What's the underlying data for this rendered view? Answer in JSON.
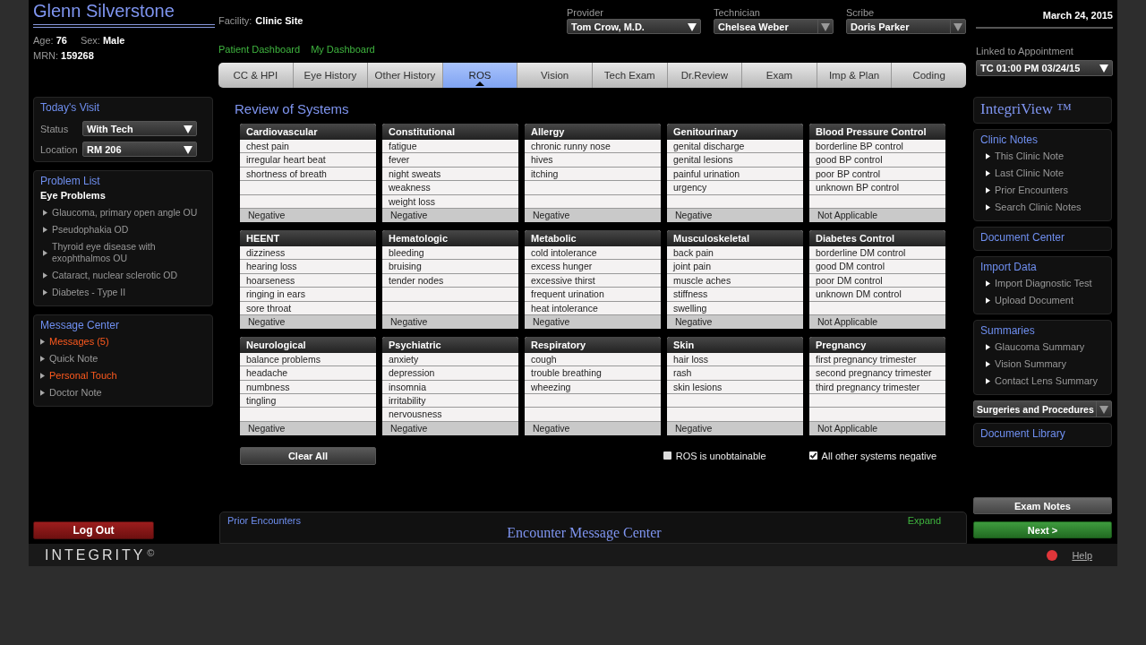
{
  "patient": {
    "name": "Glenn Silverstone",
    "age_label": "Age:",
    "age": "76",
    "sex_label": "Sex:",
    "sex": "Male",
    "mrn_label": "MRN:",
    "mrn": "159268"
  },
  "facility": {
    "label": "Facility:",
    "value": "Clinic Site"
  },
  "staff": [
    {
      "label": "Provider",
      "value": "Tom Crow, M.D.",
      "kind": "plain"
    },
    {
      "label": "Technician",
      "value": "Chelsea Weber",
      "kind": "split"
    },
    {
      "label": "Scribe",
      "value": "Doris Parker",
      "kind": "split"
    }
  ],
  "date": "March 24, 2015",
  "dashboard_links": [
    "Patient Dashboard",
    "My Dashboard"
  ],
  "appointment": {
    "label": "Linked to Appointment",
    "value": "TC 01:00 PM 03/24/15"
  },
  "tabs": [
    {
      "label": "CC & HPI",
      "selected": false
    },
    {
      "label": "Eye History",
      "selected": false
    },
    {
      "label": "Other History",
      "selected": false
    },
    {
      "label": "ROS",
      "selected": true
    },
    {
      "label": "Vision",
      "selected": false
    },
    {
      "label": "Tech Exam",
      "selected": false
    },
    {
      "label": "Dr.Review",
      "selected": false
    },
    {
      "label": "Exam",
      "selected": false
    },
    {
      "label": "Imp & Plan",
      "selected": false
    },
    {
      "label": "Coding",
      "selected": false
    }
  ],
  "todays_visit": {
    "title": "Today's Visit",
    "fields": [
      {
        "label": "Status",
        "value": "With Tech"
      },
      {
        "label": "Location",
        "value": "RM 206"
      }
    ]
  },
  "problem_list": {
    "title": "Problem List",
    "group": "Eye Problems",
    "items": [
      "Glaucoma, primary open angle OU",
      "Pseudophakia OD",
      "Thyroid eye disease with exophthalmos OU",
      "Cataract, nuclear sclerotic OD",
      "Diabetes - Type II"
    ]
  },
  "message_center": {
    "title": "Message Center",
    "items": [
      {
        "label": "Messages (5)",
        "alert": true
      },
      {
        "label": "Quick Note",
        "alert": false
      },
      {
        "label": "Personal Touch",
        "alert": true
      },
      {
        "label": "Doctor Note",
        "alert": false
      }
    ]
  },
  "logout": "Log Out",
  "ros": {
    "title": "Review of Systems",
    "systems": [
      {
        "name": "Cardiovascular",
        "items": [
          "chest pain",
          "irregular heart beat",
          "shortness of breath"
        ],
        "footer": "Negative"
      },
      {
        "name": "Constitutional",
        "items": [
          "fatigue",
          "fever",
          "night sweats",
          "weakness",
          "weight loss"
        ],
        "footer": "Negative"
      },
      {
        "name": "Allergy",
        "items": [
          "chronic runny nose",
          "hives",
          "itching"
        ],
        "footer": "Negative"
      },
      {
        "name": "Genitourinary",
        "items": [
          "genital discharge",
          "genital lesions",
          "painful urination",
          "urgency"
        ],
        "footer": "Negative"
      },
      {
        "name": "Blood Pressure Control",
        "items": [
          "borderline BP control",
          "good BP control",
          "poor BP control",
          "unknown BP control"
        ],
        "footer": "Not Applicable"
      },
      {
        "name": "HEENT",
        "items": [
          "dizziness",
          "hearing loss",
          "hoarseness",
          "ringing in ears",
          "sore throat"
        ],
        "footer": "Negative"
      },
      {
        "name": "Hematologic",
        "items": [
          "bleeding",
          "bruising",
          "tender nodes"
        ],
        "footer": "Negative"
      },
      {
        "name": "Metabolic",
        "items": [
          "cold intolerance",
          "excess hunger",
          "excessive thirst",
          "frequent urination",
          "heat intolerance"
        ],
        "footer": "Negative"
      },
      {
        "name": "Musculoskeletal",
        "items": [
          "back pain",
          "joint pain",
          "muscle aches",
          "stiffness",
          "swelling"
        ],
        "footer": "Negative"
      },
      {
        "name": "Diabetes Control",
        "items": [
          "borderline DM control",
          "good DM control",
          "poor DM control",
          "unknown DM control"
        ],
        "footer": "Not Applicable"
      },
      {
        "name": "Neurological",
        "items": [
          "balance problems",
          "headache",
          "numbness",
          "tingling"
        ],
        "footer": "Negative"
      },
      {
        "name": "Psychiatric",
        "items": [
          "anxiety",
          "depression",
          "insomnia",
          "irritability",
          "nervousness"
        ],
        "footer": "Negative"
      },
      {
        "name": "Respiratory",
        "items": [
          "cough",
          "trouble breathing",
          "wheezing"
        ],
        "footer": "Negative"
      },
      {
        "name": "Skin",
        "items": [
          "hair loss",
          "rash",
          "skin lesions"
        ],
        "footer": "Negative"
      },
      {
        "name": "Pregnancy",
        "items": [
          "first pregnancy trimester",
          "second pregnancy trimester",
          "third pregnancy trimester"
        ],
        "footer": "Not Applicable"
      }
    ],
    "clear_all": "Clear All",
    "options": [
      {
        "label": "ROS is unobtainable",
        "checked": false
      },
      {
        "label": "All other systems negative",
        "checked": true
      }
    ]
  },
  "encounter": {
    "left_link": "Prior Encounters",
    "title": "Encounter Message Center",
    "right_link": "Expand"
  },
  "integriview": {
    "title": "IntegriView ™",
    "sections": [
      {
        "title": "Clinic Notes",
        "items": [
          "This Clinic Note",
          "Last Clinic Note",
          "Prior Encounters",
          "Search Clinic Notes"
        ]
      },
      {
        "title": "Document Center"
      },
      {
        "title": "Import Data",
        "items": [
          "Import Diagnostic Test",
          "Upload Document"
        ]
      },
      {
        "title": "Summaries",
        "items": [
          "Glaucoma Summary",
          "Vision Summary",
          "Contact Lens Summary"
        ]
      }
    ],
    "dropdown": "Surgeries and Procedures",
    "library": "Document Library"
  },
  "buttons": {
    "exam_notes": "Exam Notes",
    "next": "Next >"
  },
  "footer": {
    "logo": "INTEGRITY",
    "logo_mark": "©",
    "help": "Help"
  }
}
